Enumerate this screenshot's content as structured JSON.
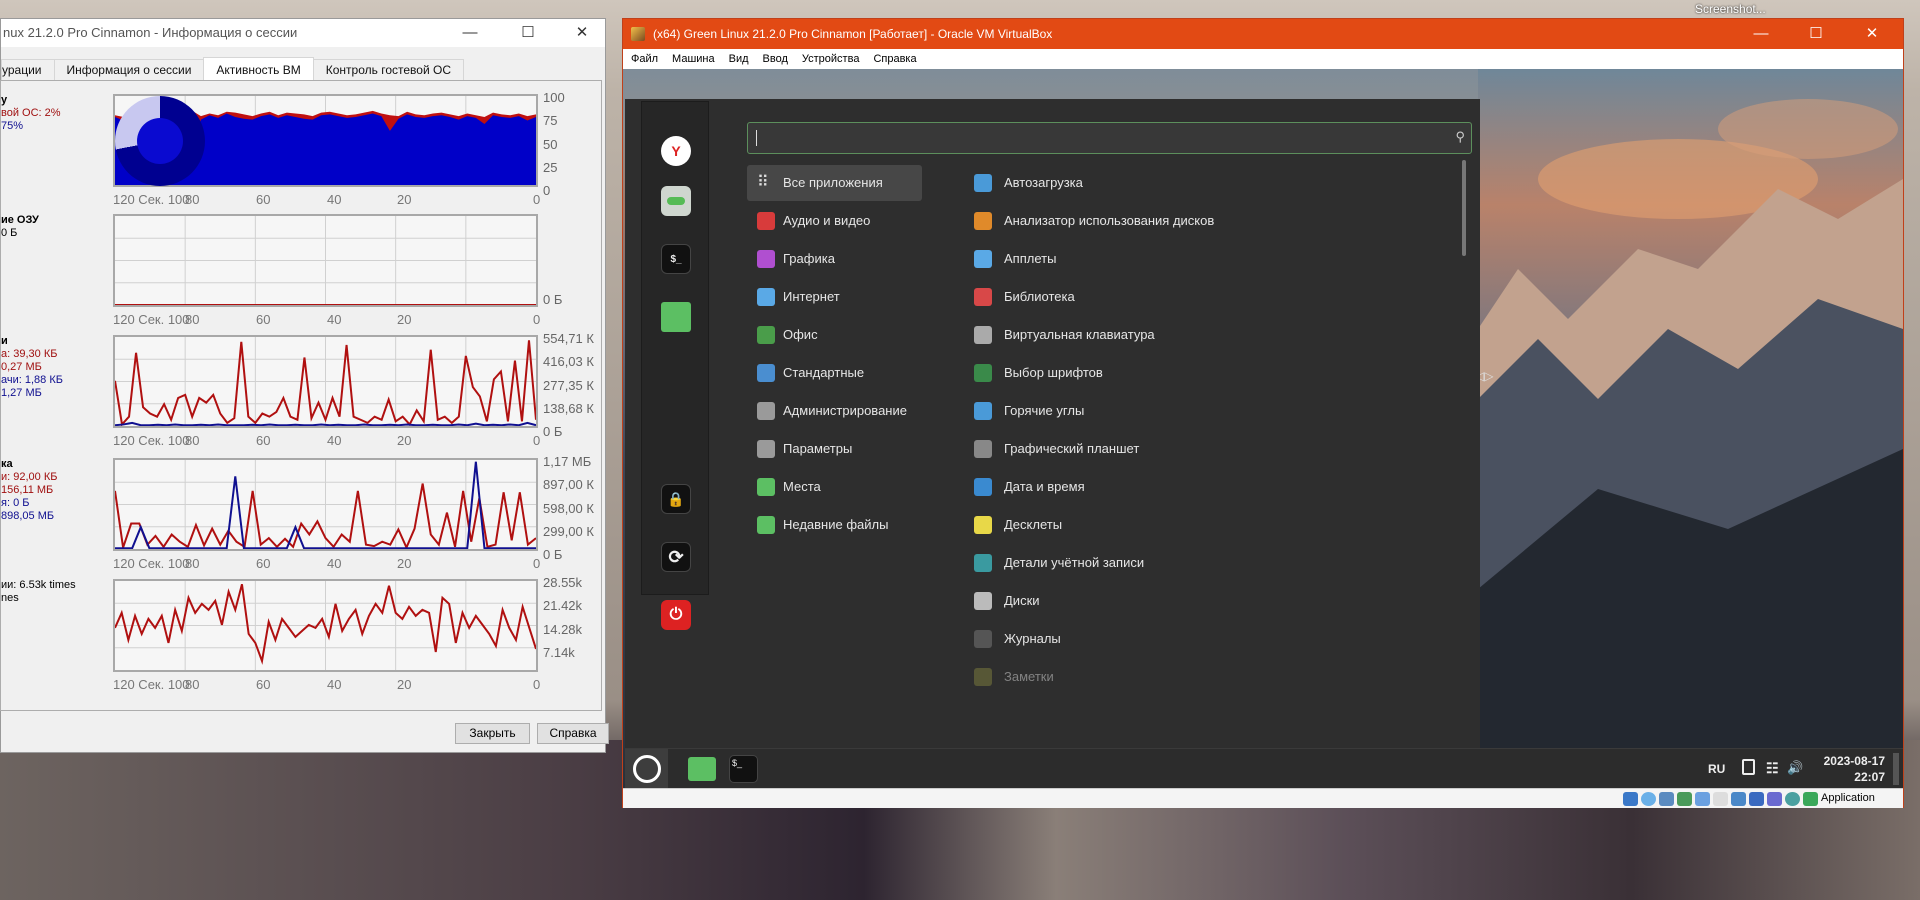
{
  "desktop": {
    "screenshot_label": "Screenshot..."
  },
  "session": {
    "title": "nux 21.2.0 Pro Cinnamon - Информация о сессии",
    "tabs": [
      {
        "label": "урации"
      },
      {
        "label": "Информация о сессии"
      },
      {
        "label": "Активность ВМ",
        "active": true
      },
      {
        "label": "Контроль гостевой ОС"
      }
    ],
    "close_label": "Закрыть",
    "help_label": "Справка",
    "x_ticks": [
      "120 Сек. 100",
      "80",
      "60",
      "40",
      "20",
      "0"
    ],
    "graphs": [
      {
        "labels": [
          {
            "t": "у",
            "c": "b"
          },
          {
            "t": "вой ОС: 2%",
            "c": "r"
          },
          {
            "t": "75%",
            "c": "u"
          }
        ],
        "y_ticks": [
          "100",
          "75",
          "50",
          "25",
          "0"
        ],
        "max": 100,
        "red": [
          80,
          78,
          82,
          79,
          84,
          80,
          76,
          83,
          81,
          85,
          79,
          82,
          80,
          84,
          83,
          81,
          79,
          82,
          84,
          80,
          83,
          82,
          81,
          79,
          83,
          84,
          82,
          80,
          81,
          83,
          85,
          82,
          80,
          79,
          84,
          81,
          80,
          82,
          83,
          81,
          79,
          82,
          80,
          78,
          83,
          81,
          80,
          82,
          79,
          81
        ],
        "blue": [
          78,
          74,
          80,
          76,
          70,
          78,
          72,
          80,
          79,
          30,
          75,
          80,
          77,
          82,
          78,
          76,
          75,
          79,
          81,
          77,
          80,
          78,
          76,
          75,
          80,
          81,
          79,
          77,
          78,
          80,
          82,
          79,
          62,
          76,
          81,
          78,
          77,
          79,
          80,
          78,
          75,
          79,
          77,
          70,
          80,
          78,
          77,
          79,
          74,
          78
        ]
      },
      {
        "labels": [
          {
            "t": "ие ОЗУ",
            "c": "b"
          },
          {
            "t": "0 Б",
            "c": "k"
          }
        ],
        "y_ticks": [
          "0 Б"
        ],
        "max": 100,
        "red": [
          0,
          0,
          0,
          0,
          0,
          0,
          0,
          0,
          0,
          0,
          0,
          0,
          0,
          0,
          0,
          0,
          0,
          0,
          0,
          0
        ],
        "blue": []
      },
      {
        "labels": [
          {
            "t": "и",
            "c": "b"
          },
          {
            "t": "а: 39,30 КБ",
            "c": "r"
          },
          {
            "t": "0,27 МБ",
            "c": "r"
          },
          {
            "t": "ачи: 1,88 КБ",
            "c": "u"
          },
          {
            "t": "1,27 МБ",
            "c": "u"
          }
        ],
        "y_ticks": [
          "554,71 К",
          "416,03 К",
          "277,35 К",
          "138,68 К",
          "0 Б"
        ],
        "max": 560,
        "red": [
          290,
          10,
          60,
          470,
          120,
          80,
          60,
          140,
          40,
          180,
          200,
          60,
          180,
          150,
          200,
          80,
          20,
          50,
          540,
          60,
          20,
          80,
          60,
          90,
          180,
          60,
          40,
          440,
          50,
          150,
          40,
          180,
          60,
          520,
          60,
          40,
          20,
          60,
          40,
          170,
          30,
          60,
          10,
          100,
          30,
          490,
          40,
          60,
          20,
          60,
          450,
          250,
          190,
          30,
          300,
          350,
          30,
          420,
          30,
          550,
          40
        ],
        "blue": [
          5,
          10,
          20,
          5,
          5,
          8,
          5,
          10,
          5,
          5,
          8,
          5,
          10,
          5,
          5,
          5,
          8,
          5,
          10,
          5,
          5,
          8,
          5,
          5,
          10,
          5,
          8,
          5,
          5,
          10,
          5,
          5,
          8,
          5,
          10,
          5,
          5,
          8,
          5,
          5,
          10,
          5,
          15,
          5,
          8,
          5,
          10,
          5,
          20,
          5
        ]
      },
      {
        "labels": [
          {
            "t": "ка",
            "c": "b"
          },
          {
            "t": "и: 92,00 КБ",
            "c": "r"
          },
          {
            "t": "156,11 МБ",
            "c": "r"
          },
          {
            "t": "я: 0 Б",
            "c": "u"
          },
          {
            "t": "898,05 МБ",
            "c": "u"
          }
        ],
        "y_ticks": [
          "1,17 МБ",
          "897,00 К",
          "598,00 К",
          "299,00 К",
          "0 Б"
        ],
        "max": 1200,
        "red": [
          800,
          20,
          350,
          350,
          60,
          180,
          30,
          200,
          100,
          30,
          330,
          50,
          280,
          60,
          250,
          100,
          30,
          800,
          60,
          150,
          30,
          140,
          30,
          350,
          200,
          380,
          150,
          30,
          200,
          100,
          800,
          60,
          40,
          100,
          60,
          270,
          20,
          280,
          900,
          200,
          60,
          500,
          30,
          800,
          100,
          700,
          30,
          60,
          780,
          120,
          780,
          60,
          150
        ],
        "blue": [
          10,
          10,
          10,
          300,
          10,
          10,
          10,
          10,
          10,
          10,
          10,
          10,
          10,
          10,
          1000,
          10,
          10,
          10,
          10,
          10,
          10,
          300,
          10,
          10,
          10,
          10,
          10,
          10,
          10,
          10,
          10,
          10,
          10,
          10,
          10,
          10,
          10,
          10,
          10,
          10,
          10,
          10,
          1200,
          10,
          10,
          10,
          10,
          10,
          10,
          10
        ],
        "blue_only_spikes": true
      },
      {
        "labels": [
          {
            "t": "ии: 6.53k times",
            "c": "k"
          },
          {
            "t": "nes",
            "c": "k"
          }
        ],
        "y_ticks": [
          "28.55k",
          "21.42k",
          "14.28k",
          "7.14k"
        ],
        "max": 29000,
        "red": [
          14000,
          19000,
          10000,
          18000,
          12000,
          17000,
          14000,
          18000,
          9000,
          20000,
          13000,
          24000,
          19000,
          22000,
          20000,
          23000,
          15000,
          26000,
          20000,
          28500,
          12000,
          9000,
          3000,
          16000,
          10000,
          17000,
          14000,
          11000,
          13000,
          15000,
          14000,
          17000,
          11000,
          22000,
          13000,
          17000,
          20000,
          12000,
          18000,
          22000,
          19000,
          28000,
          19000,
          17000,
          21000,
          18000,
          20000,
          19000,
          6000,
          24000,
          22000,
          9000,
          19000,
          14000,
          18000,
          15000,
          12000,
          8000,
          20000,
          14000,
          10000,
          21000,
          14000,
          7000
        ]
      }
    ]
  },
  "vbox": {
    "title": "(x64) Green Linux 21.2.0 Pro Cinnamon [Работает] - Oracle VM VirtualBox",
    "menu": [
      "Файл",
      "Машина",
      "Вид",
      "Ввод",
      "Устройства",
      "Справка"
    ],
    "status_text": "Application"
  },
  "guest": {
    "search_value": "",
    "categories": [
      {
        "label": "Все приложения",
        "color": "#474747"
      },
      {
        "label": "Аудио и видео",
        "color": "#d83b3b"
      },
      {
        "label": "Графика",
        "color": "#b04fd0"
      },
      {
        "label": "Интернет",
        "color": "#5aa9e6"
      },
      {
        "label": "Офис",
        "color": "#4a9d4a"
      },
      {
        "label": "Стандартные",
        "color": "#4a8ed0"
      },
      {
        "label": "Администрирование",
        "color": "#9a9a9a"
      },
      {
        "label": "Параметры",
        "color": "#9a9a9a"
      },
      {
        "label": "Места",
        "color": "#5cbf63"
      },
      {
        "label": "Недавние файлы",
        "color": "#5cbf63"
      }
    ],
    "apps": [
      {
        "label": "Автозагрузка",
        "color": "#4a9ad8"
      },
      {
        "label": "Анализатор использования дисков",
        "color": "#e08a2a"
      },
      {
        "label": "Апплеты",
        "color": "#5aa9e6"
      },
      {
        "label": "Библиотека",
        "color": "#d84848"
      },
      {
        "label": "Виртуальная клавиатура",
        "color": "#aaaaaa"
      },
      {
        "label": "Выбор шрифтов",
        "color": "#3a8a4a"
      },
      {
        "label": "Горячие углы",
        "color": "#4a9ad8"
      },
      {
        "label": "Графический планшет",
        "color": "#888888"
      },
      {
        "label": "Дата и время",
        "color": "#3a8ad0"
      },
      {
        "label": "Десклеты",
        "color": "#e8d848"
      },
      {
        "label": "Детали учётной записи",
        "color": "#3a9aa0"
      },
      {
        "label": "Диски",
        "color": "#bbbbbb"
      },
      {
        "label": "Журналы",
        "color": "#555555"
      },
      {
        "label": "Заметки",
        "color": "#8a8a40",
        "dim": true
      }
    ],
    "tray": {
      "lang": "RU",
      "date": "2023-08-17",
      "time": "22:07"
    }
  }
}
